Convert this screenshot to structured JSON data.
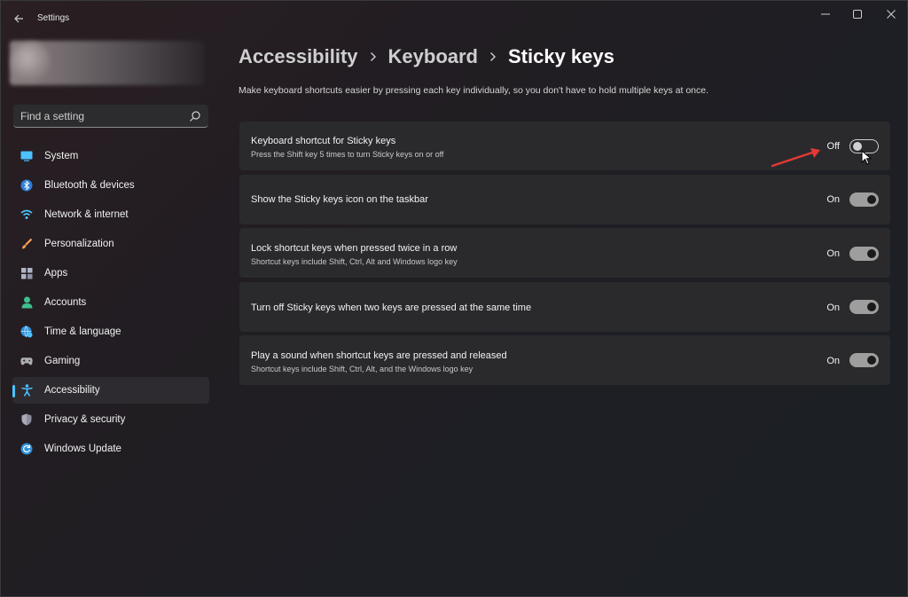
{
  "app": {
    "title": "Settings"
  },
  "search": {
    "placeholder": "Find a setting"
  },
  "nav": {
    "items": [
      {
        "label": "System",
        "icon": "monitor-icon",
        "color": "#4cc2ff"
      },
      {
        "label": "Bluetooth & devices",
        "icon": "bluetooth-icon",
        "color": "#4cc2ff"
      },
      {
        "label": "Network & internet",
        "icon": "wifi-icon",
        "color": "#4cc2ff"
      },
      {
        "label": "Personalization",
        "icon": "brush-icon",
        "color": "#f7a35a"
      },
      {
        "label": "Apps",
        "icon": "apps-grid-icon",
        "color": "#b0b4c8"
      },
      {
        "label": "Accounts",
        "icon": "person-icon",
        "color": "#3fbf8f"
      },
      {
        "label": "Time & language",
        "icon": "globe-clock-icon",
        "color": "#4cc2ff"
      },
      {
        "label": "Gaming",
        "icon": "gamepad-icon",
        "color": "#b0b0b0"
      },
      {
        "label": "Accessibility",
        "icon": "accessibility-icon",
        "color": "#4cc2ff",
        "selected": true
      },
      {
        "label": "Privacy & security",
        "icon": "shield-icon",
        "color": "#8c8c9c"
      },
      {
        "label": "Windows Update",
        "icon": "update-icon",
        "color": "#4cc2ff"
      }
    ]
  },
  "breadcrumb": {
    "level1": "Accessibility",
    "level2": "Keyboard",
    "current": "Sticky keys"
  },
  "page": {
    "description": "Make keyboard shortcuts easier by pressing each key individually, so you don't have to hold multiple keys at once."
  },
  "settings": [
    {
      "title": "Keyboard shortcut for Sticky keys",
      "subtitle": "Press the Shift key 5 times to turn Sticky keys on or off",
      "state": "Off",
      "on": false
    },
    {
      "title": "Show the Sticky keys icon on the taskbar",
      "subtitle": "",
      "state": "On",
      "on": true
    },
    {
      "title": "Lock shortcut keys when pressed twice in a row",
      "subtitle": "Shortcut keys include Shift, Ctrl, Alt and Windows logo key",
      "state": "On",
      "on": true
    },
    {
      "title": "Turn off Sticky keys when two keys are pressed at the same time",
      "subtitle": "",
      "state": "On",
      "on": true
    },
    {
      "title": "Play a sound when shortcut keys are pressed and released",
      "subtitle": "Shortcut keys include Shift, Ctrl, Alt, and the Windows logo key",
      "state": "On",
      "on": true
    }
  ],
  "colors": {
    "accent": "#4cc2ff",
    "annotation_arrow": "#e53935"
  }
}
